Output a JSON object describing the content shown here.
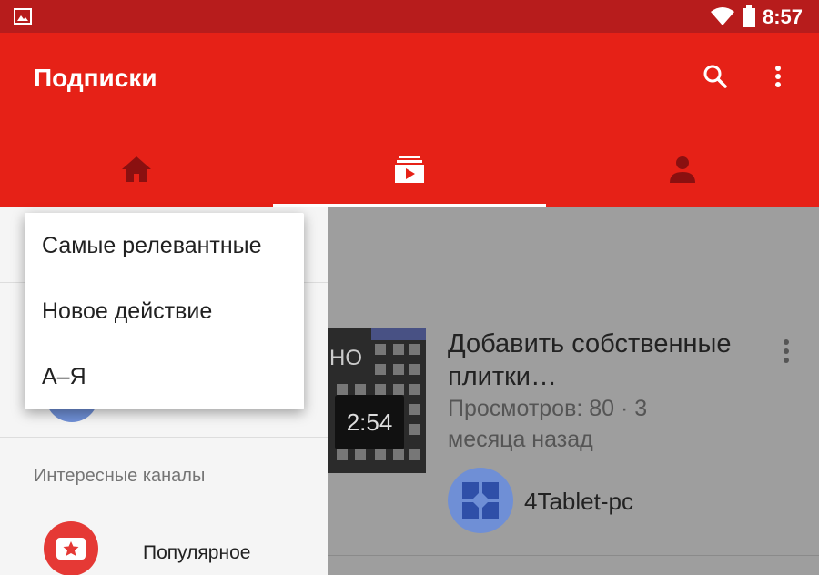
{
  "status_bar": {
    "time": "8:57",
    "icons": [
      "image-icon",
      "wifi-icon",
      "battery-icon"
    ]
  },
  "app_bar": {
    "title": "Подписки",
    "color": "#e62117",
    "actions": [
      "search-icon",
      "more-vert-icon"
    ]
  },
  "tabs": [
    {
      "icon": "home-icon",
      "selected": false
    },
    {
      "icon": "subscriptions-icon",
      "selected": true
    },
    {
      "icon": "account-icon",
      "selected": false
    }
  ],
  "sort_menu": {
    "items": [
      {
        "label": "Самые релевантные"
      },
      {
        "label": "Новое действие"
      },
      {
        "label": "А–Я"
      }
    ]
  },
  "channels": {
    "section_title": "Интересные каналы",
    "items": [
      {
        "name": "Популярное",
        "icon": "star-icon",
        "color": "#e53935"
      }
    ]
  },
  "video": {
    "thumb_text": "НО",
    "duration": "2:54",
    "title": "Добавить собственные плитки…",
    "meta": "Просмотров: 80 · 3 месяца назад",
    "uploader": "4Tablet-pc"
  }
}
